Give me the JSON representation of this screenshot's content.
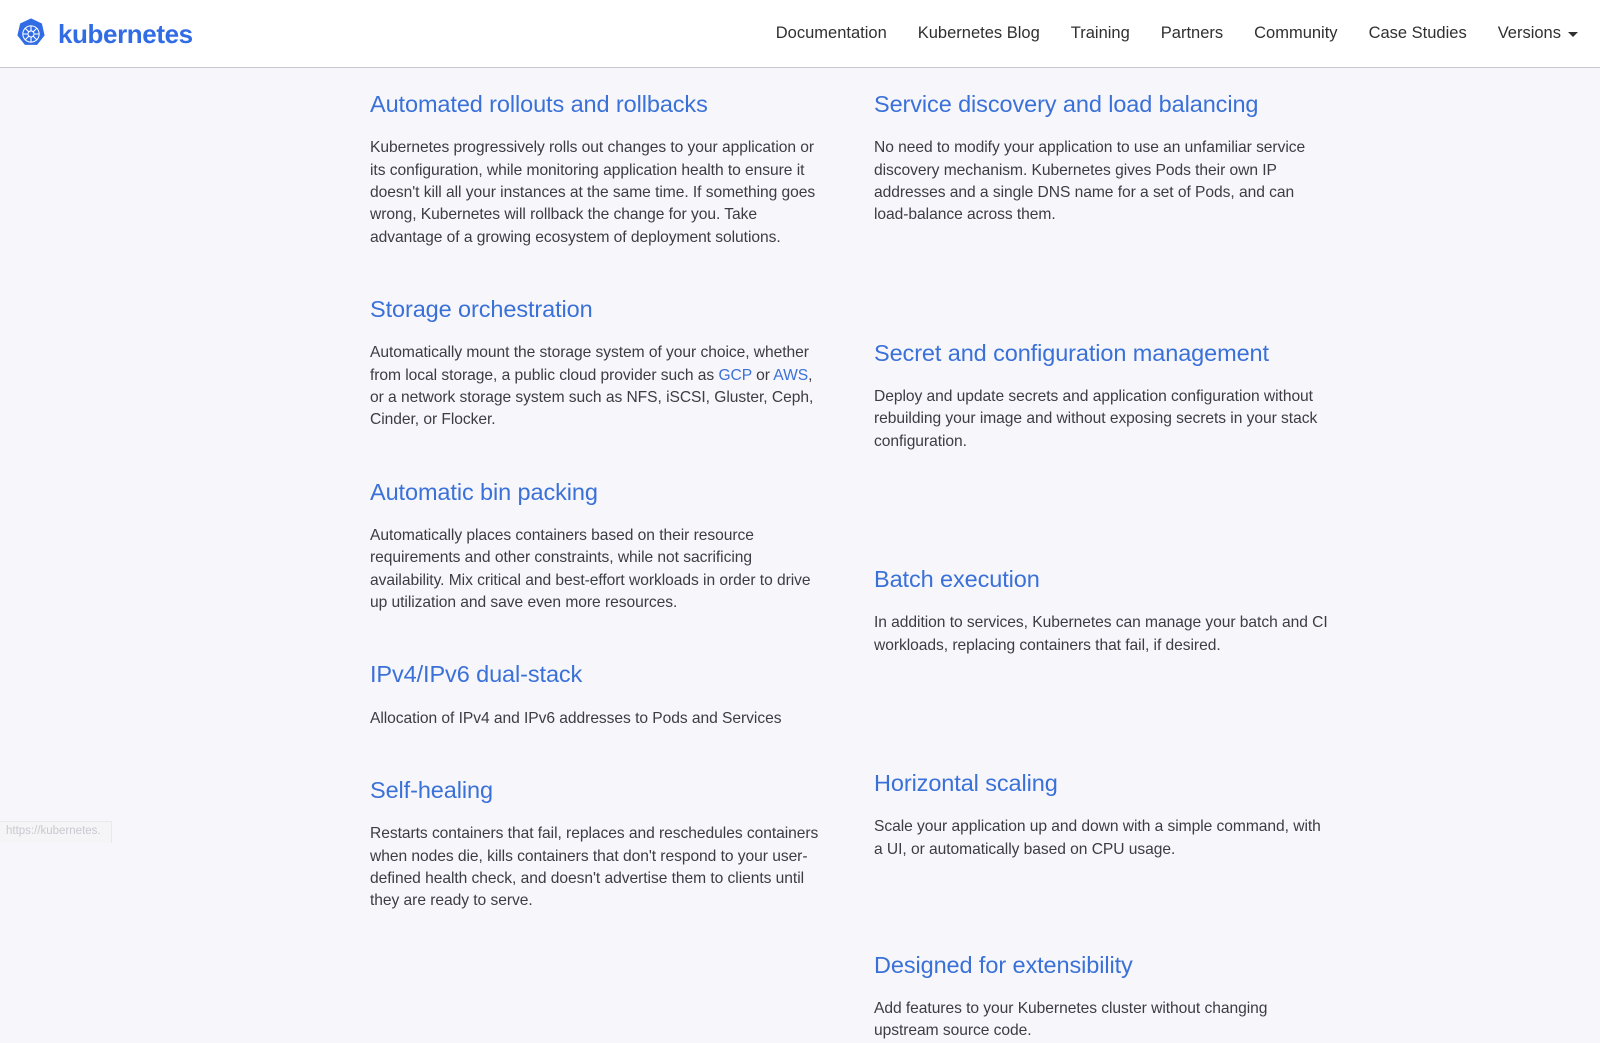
{
  "header": {
    "brand": {
      "name": "kubernetes",
      "logo_icon": "kubernetes-wheel-icon",
      "logo_color": "#326ce5"
    },
    "nav_items": [
      {
        "label": "Documentation"
      },
      {
        "label": "Kubernetes Blog"
      },
      {
        "label": "Training"
      },
      {
        "label": "Partners"
      },
      {
        "label": "Community"
      },
      {
        "label": "Case Studies"
      }
    ],
    "versions_dropdown": {
      "label": "Versions",
      "caret_icon": "chevron-down-icon"
    }
  },
  "features": {
    "left_column": [
      {
        "title": "Automated rollouts and rollbacks",
        "body": "Kubernetes progressively rolls out changes to your application or its configuration, while monitoring application health to ensure it doesn't kill all your instances at the same time. If something goes wrong, Kubernetes will rollback the change for you. Take advantage of a growing ecosystem of deployment solutions."
      },
      {
        "title": "Storage orchestration",
        "body_part_1": "Automatically mount the storage system of your choice, whether from local storage, a public cloud provider such as ",
        "link_1": "GCP",
        "body_part_2": " or ",
        "link_2": "AWS",
        "body_part_3": ", or a network storage system such as NFS, iSCSI, Gluster, Ceph, Cinder, or Flocker."
      },
      {
        "title": "Automatic bin packing",
        "body": "Automatically places containers based on their resource requirements and other constraints, while not sacrificing availability. Mix critical and best-effort workloads in order to drive up utilization and save even more resources."
      },
      {
        "title": "IPv4/IPv6 dual-stack",
        "body": "Allocation of IPv4 and IPv6 addresses to Pods and Services"
      },
      {
        "title": "Self-healing",
        "body": "Restarts containers that fail, replaces and reschedules containers when nodes die, kills containers that don't respond to your user-defined health check, and doesn't advertise them to clients until they are ready to serve."
      }
    ],
    "right_column": [
      {
        "title": "Service discovery and load balancing",
        "body": "No need to modify your application to use an unfamiliar service discovery mechanism. Kubernetes gives Pods their own IP addresses and a single DNS name for a set of Pods, and can load-balance across them."
      },
      {
        "title": "Secret and configuration management",
        "body": "Deploy and update secrets and application configuration without rebuilding your image and without exposing secrets in your stack configuration."
      },
      {
        "title": "Batch execution",
        "body": "In addition to services, Kubernetes can manage your batch and CI workloads, replacing containers that fail, if desired."
      },
      {
        "title": "Horizontal scaling",
        "body": "Scale your application up and down with a simple command, with a UI, or automatically based on CPU usage."
      },
      {
        "title": "Designed for extensibility",
        "body": "Add features to your Kubernetes cluster without changing upstream source code."
      }
    ]
  },
  "status_bar": {
    "url": "https://kubernetes."
  },
  "colors": {
    "brand_blue": "#326ce5",
    "heading_blue": "#3a71d8",
    "body_text": "#3c3c43",
    "page_background": "#f7f6fa",
    "header_background": "#ffffff"
  }
}
